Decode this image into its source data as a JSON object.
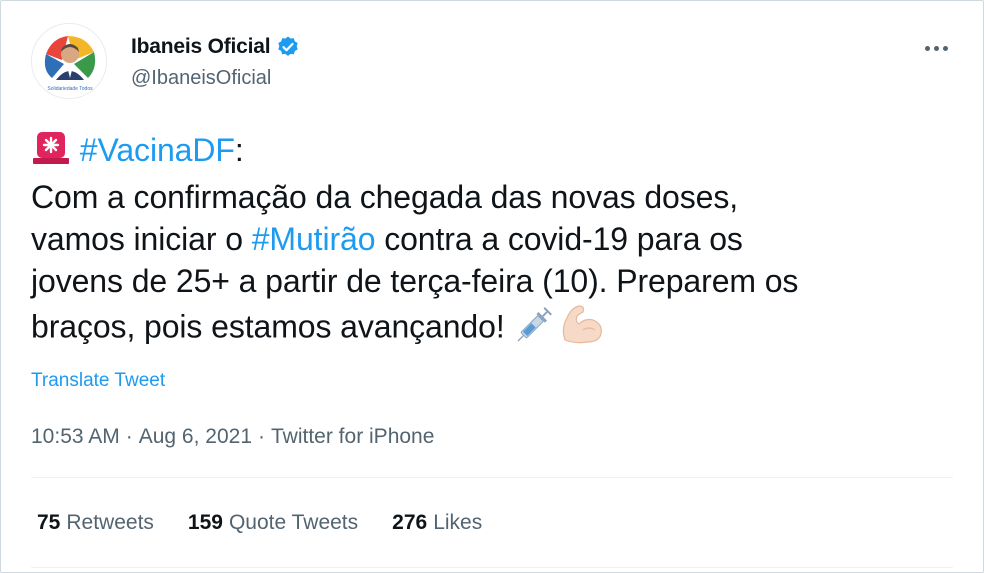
{
  "author": {
    "display_name": "Ibaneis Oficial",
    "handle": "@IbaneisOficial",
    "verified_icon": "verified-badge-icon",
    "avatar_caption": "Solidariedade Todos"
  },
  "menu_icon": "more-options-icon",
  "tweet": {
    "alert_icon": "rotating-light-icon",
    "hashtag1": "#VacinaDF",
    "after_hashtag1": ":",
    "line2": "Com a confirmação da chegada das novas doses,",
    "line3_before": "vamos iniciar o ",
    "hashtag2": "#Mutirão",
    "line3_after": " contra a covid-19 para os",
    "line4": "jovens de 25+ a partir de terça-feira (10). Preparem os",
    "line5": "braços, pois estamos avançando! ",
    "syringe_icon": "syringe-icon",
    "muscle_icon": "flexed-biceps-icon"
  },
  "translate_label": "Translate Tweet",
  "meta": {
    "time": "10:53 AM",
    "sep": "·",
    "date": "Aug 6, 2021",
    "source": "Twitter for iPhone"
  },
  "stats": {
    "retweets_count": "75",
    "retweets_label": "Retweets",
    "quotes_count": "159",
    "quotes_label": "Quote Tweets",
    "likes_count": "276",
    "likes_label": "Likes"
  },
  "colors": {
    "link": "#1d9bf0",
    "secondary_text": "#536471",
    "primary_text": "#0f1419",
    "alert_red": "#e0245e"
  }
}
